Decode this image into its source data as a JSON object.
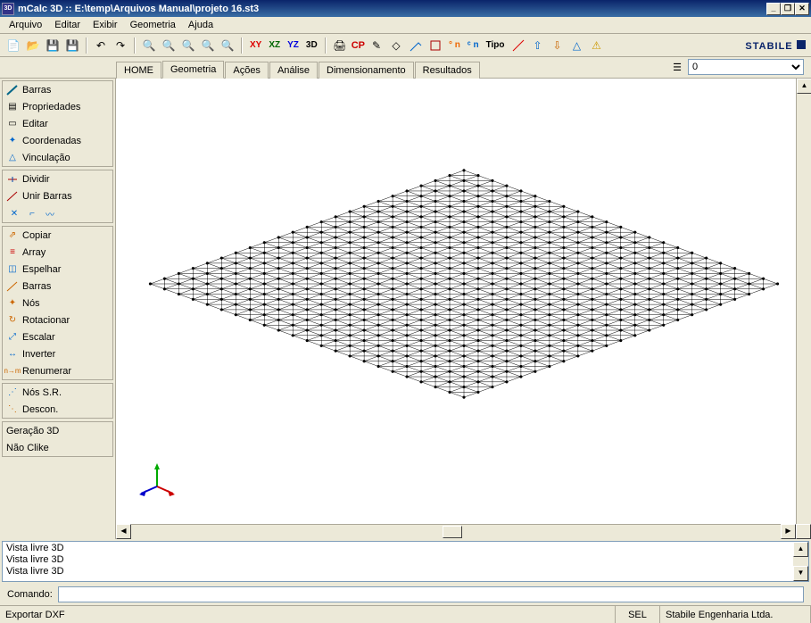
{
  "titlebar": {
    "icon_label": "3D",
    "title": "mCalc 3D :: E:\\temp\\Arquivos Manual\\projeto 16.st3",
    "min": "_",
    "restore": "❐",
    "close": "✕"
  },
  "menu": {
    "items": [
      "Arquivo",
      "Editar",
      "Exibir",
      "Geometria",
      "Ajuda"
    ]
  },
  "toolbar": {
    "view_planes": {
      "xy": "XY",
      "xz": "XZ",
      "yz": "YZ",
      "d3": "3D"
    },
    "cp": "CP",
    "on_label": "° n",
    "cn_label": "ᶜ n",
    "tipo_label": "Tipo",
    "brand": "STABILE"
  },
  "tabs": {
    "items": [
      "HOME",
      "Geometria",
      "Ações",
      "Análise",
      "Dimensionamento",
      "Resultados"
    ],
    "active_index": 1
  },
  "combo": {
    "selected": "0"
  },
  "sidebar": {
    "g0": [
      {
        "label": "Barras"
      },
      {
        "label": "Propriedades"
      },
      {
        "label": "Editar"
      },
      {
        "label": "Coordenadas"
      },
      {
        "label": "Vinculação"
      }
    ],
    "g1": [
      {
        "label": "Dividir"
      },
      {
        "label": "Unir Barras"
      }
    ],
    "g2": [
      {
        "label": "Copiar"
      },
      {
        "label": "Array"
      },
      {
        "label": "Espelhar"
      },
      {
        "label": "Barras"
      },
      {
        "label": "Nós"
      },
      {
        "label": "Rotacionar"
      },
      {
        "label": "Escalar"
      },
      {
        "label": "Inverter"
      },
      {
        "label": "Renumerar"
      }
    ],
    "g3": [
      {
        "label": "Nós S.R."
      },
      {
        "label": "Descon."
      }
    ],
    "g4": [
      {
        "label": "Geração 3D"
      },
      {
        "label": "Não Clike"
      }
    ]
  },
  "log": {
    "lines": [
      "Vista livre 3D",
      "Vista livre 3D",
      "Vista livre 3D"
    ]
  },
  "command": {
    "label": "Comando:",
    "value": ""
  },
  "statusbar": {
    "left": "Exportar DXF",
    "mid": "SEL",
    "right": "Stabile Engenharia Ltda."
  }
}
